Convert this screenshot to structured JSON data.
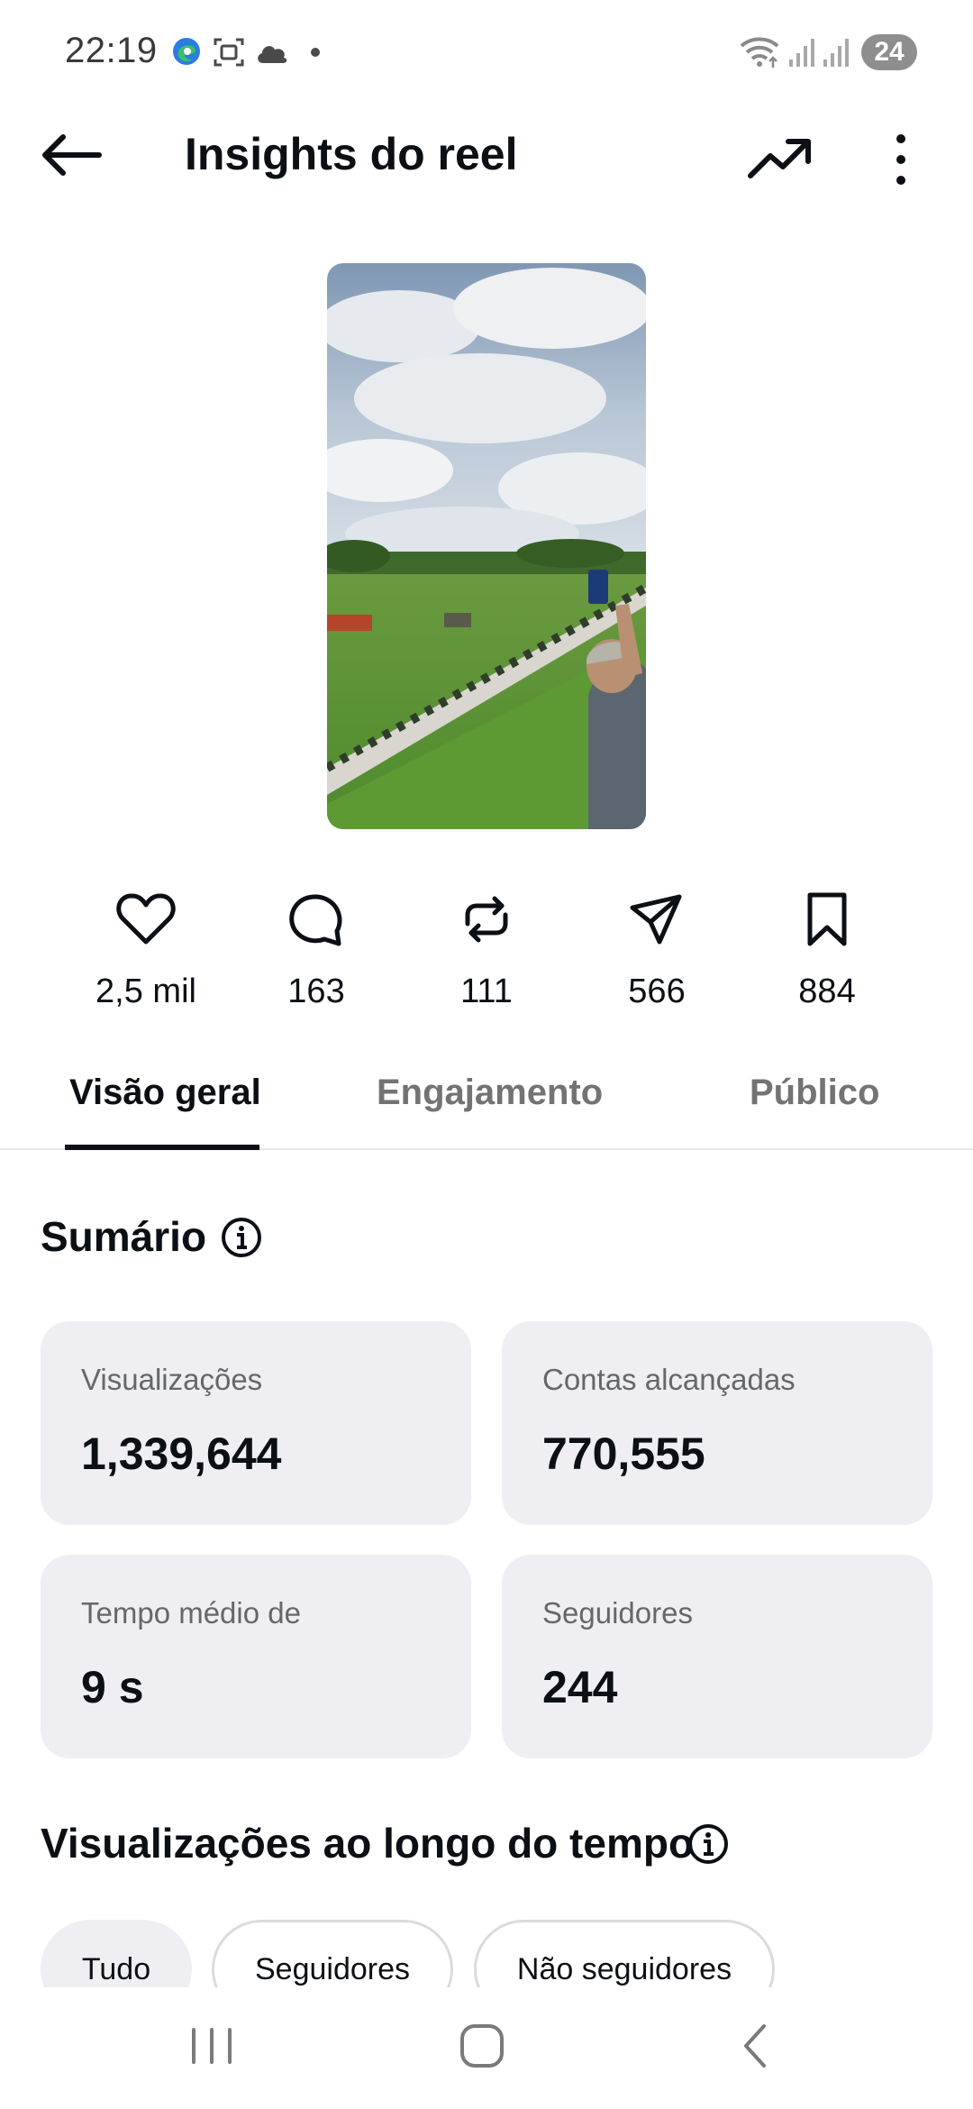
{
  "status_bar": {
    "time": "22:19",
    "icons": [
      "edge-icon",
      "screenshot-icon",
      "cloud-icon",
      "dot-icon",
      "wifi-icon",
      "signal-icon",
      "signal-icon"
    ],
    "battery": "24"
  },
  "header": {
    "title": "Insights do reel",
    "back_icon": "arrow-left-icon",
    "trend_icon": "trending-up-icon",
    "more_icon": "more-vertical-icon"
  },
  "reel": {
    "thumbnail": "video-thumbnail"
  },
  "stats": [
    {
      "icon": "heart-icon",
      "value": "2,5 mil"
    },
    {
      "icon": "comment-icon",
      "value": "163"
    },
    {
      "icon": "repost-icon",
      "value": "111"
    },
    {
      "icon": "share-icon",
      "value": "566"
    },
    {
      "icon": "bookmark-icon",
      "value": "884"
    }
  ],
  "tabs": [
    {
      "label": "Visão geral",
      "active": true
    },
    {
      "label": "Engajamento",
      "active": false
    },
    {
      "label": "Público",
      "active": false
    }
  ],
  "summary": {
    "title": "Sumário",
    "cards": [
      {
        "label": "Visualizações",
        "value": "1,339,644"
      },
      {
        "label": "Contas alcançadas",
        "value": "770,555"
      },
      {
        "label": "Tempo médio de",
        "value": "9 s"
      },
      {
        "label": "Seguidores",
        "value": "244"
      }
    ]
  },
  "views_over_time": {
    "title": "Visualizações ao longo do tempo",
    "filters": [
      {
        "label": "Tudo",
        "selected": true
      },
      {
        "label": "Seguidores",
        "selected": false
      },
      {
        "label": "Não seguidores",
        "selected": false
      }
    ]
  },
  "colors": {
    "text_primary": "#0c1014",
    "text_secondary": "#737373",
    "card_bg": "#efeff3"
  }
}
